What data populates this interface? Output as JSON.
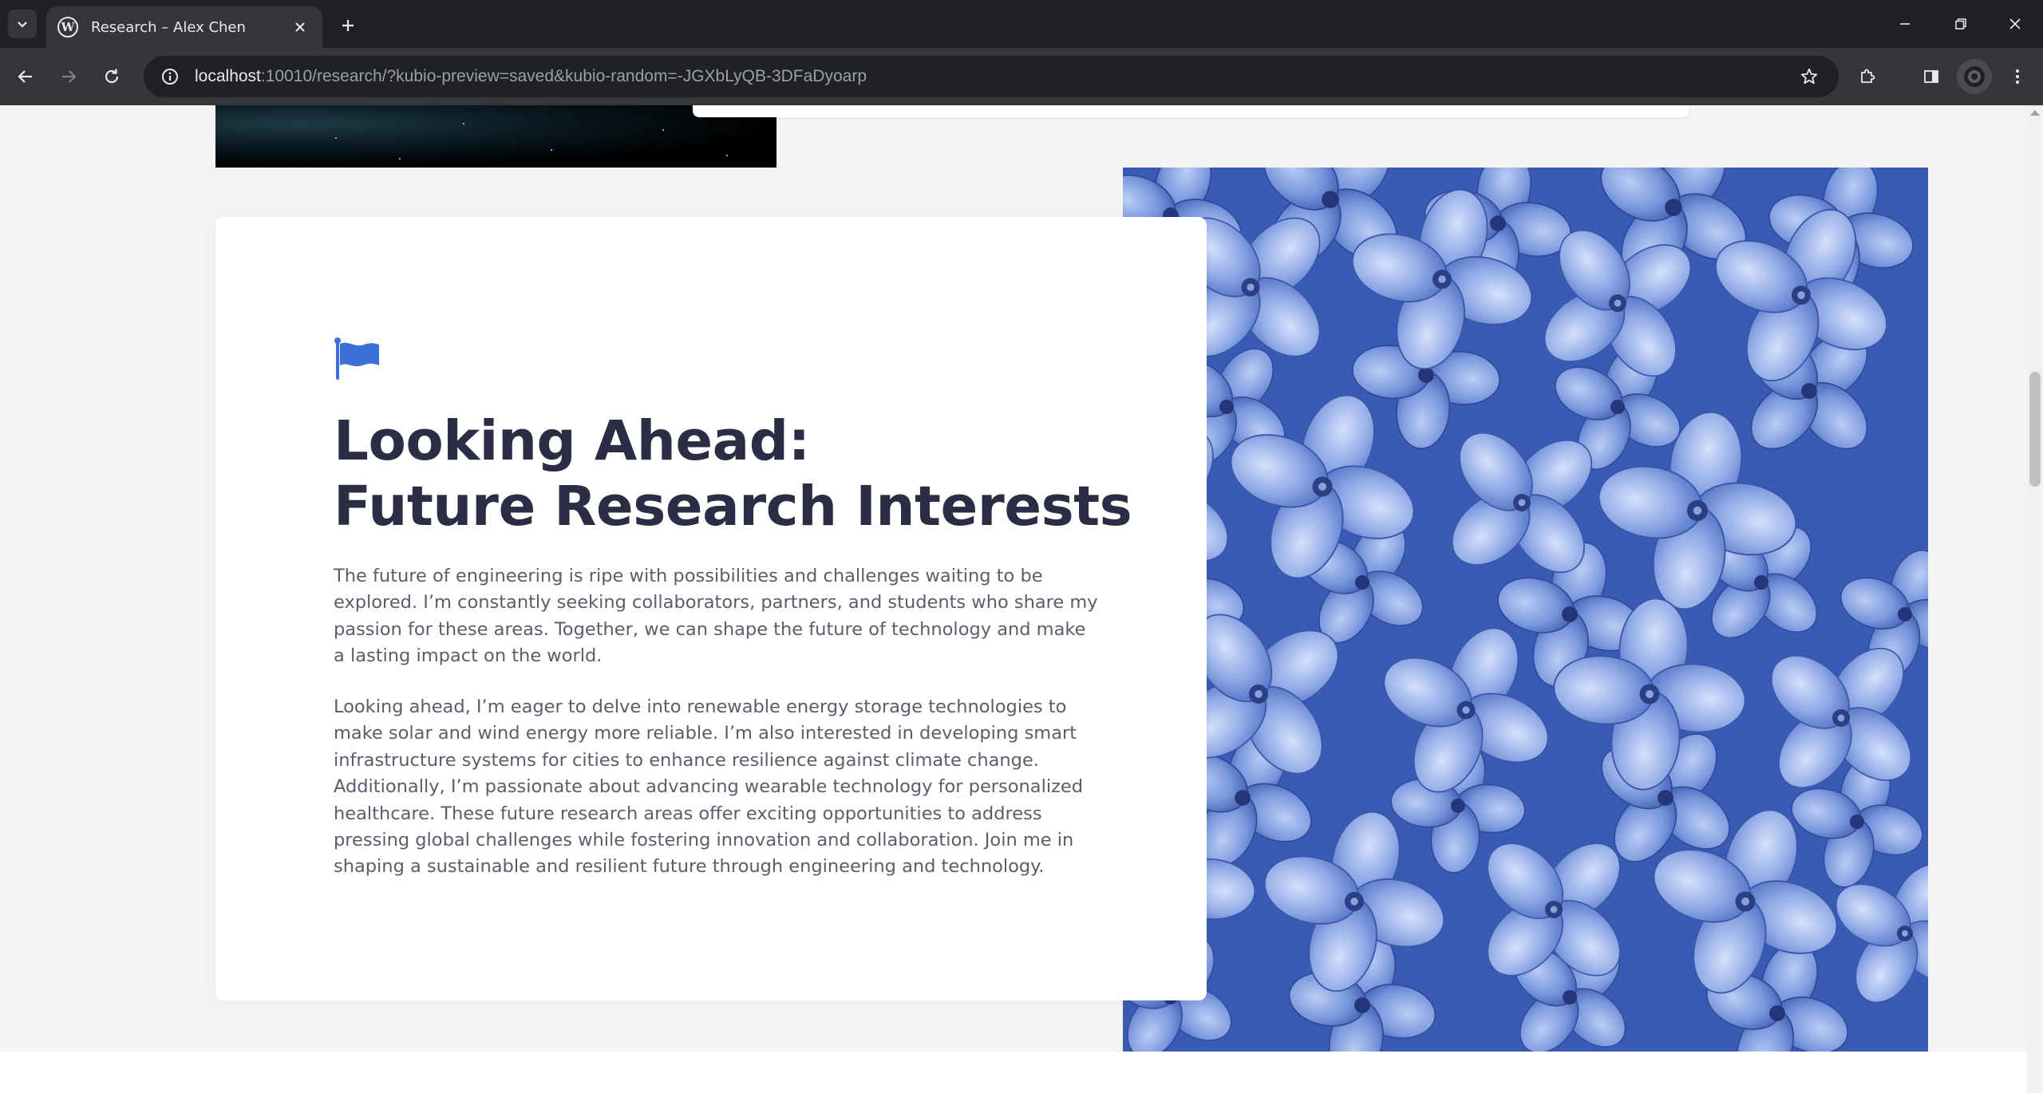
{
  "browser": {
    "tab_title": "Research – Alex Chen",
    "url_host": "localhost",
    "url_rest": ":10010/research/?kubio-preview=saved&kubio-random=-JGXbLyQB-3DFaDyoarp",
    "favicon_letter": "W",
    "icons": {
      "tab_search": "chevron-down-icon",
      "close_tab": "close-icon",
      "new_tab": "plus-icon",
      "back": "arrow-left-icon",
      "forward": "arrow-right-icon",
      "reload": "reload-icon",
      "site_info": "info-icon",
      "bookmark": "star-icon",
      "extensions": "puzzle-icon",
      "side_panel": "side-panel-icon",
      "profile": "avatar-icon",
      "menu": "kebab-menu-icon",
      "minimize": "minimize-icon",
      "restore": "restore-icon",
      "close_window": "close-icon"
    }
  },
  "section": {
    "icon": "flag-icon",
    "heading_line1": "Looking Ahead:",
    "heading_line2": "Future Research Interests",
    "paragraph1": "The future of engineering is ripe with possibilities and challenges waiting to be explored. I’m constantly seeking collaborators, partners, and students who share my passion for these areas. Together, we can shape the future of technology and make a lasting impact on the world.",
    "paragraph2": "Looking ahead, I’m eager to delve into renewable energy storage technologies to make solar and wind energy more reliable. I’m also interested in developing smart infrastructure systems for cities to enhance resilience against climate change. Additionally, I’m passionate about advancing wearable technology for personalized healthcare. These future research areas offer exciting opportunities to address pressing global challenges while fostering innovation and collaboration. Join me in shaping a sustainable and resilient future through engineering and technology.",
    "image": "blue hydrangea flowers"
  },
  "colors": {
    "accent": "#3b6fd8",
    "heading": "#2a2d43",
    "body_text": "#5a5d6b",
    "page_bg": "#f3f3f3"
  }
}
